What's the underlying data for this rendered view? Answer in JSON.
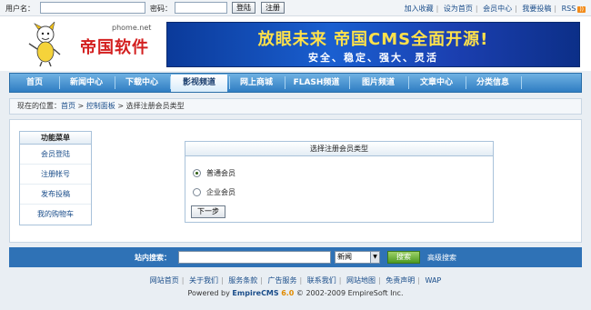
{
  "topbar": {
    "username_label": "用户名：",
    "password_label": "密码：",
    "login_button": "登陆",
    "register_button": "注册",
    "links": [
      "加入收藏",
      "设为首页",
      "会员中心",
      "我要投稿",
      "RSS"
    ]
  },
  "header": {
    "logo_site": "phome.net",
    "logo_text": "帝国软件",
    "banner_line1": "放眼未来 帝国CMS全面开源!",
    "banner_line2": "安全、稳定、强大、灵活"
  },
  "nav": {
    "items": [
      "首页",
      "新闻中心",
      "下载中心",
      "影视频道",
      "网上商城",
      "FLASH频道",
      "图片频道",
      "文章中心",
      "分类信息"
    ],
    "active_index": 3
  },
  "breadcrumb": {
    "prefix": "现在的位置：",
    "home": "首页",
    "sep1": " > ",
    "panel": "控制面板",
    "sep2": " > ",
    "current": "选择注册会员类型"
  },
  "menu": {
    "title": "功能菜单",
    "items": [
      "会员登陆",
      "注册帐号",
      "发布投稿",
      "我的购物车"
    ]
  },
  "panel": {
    "title": "选择注册会员类型",
    "options": [
      "普通会员",
      "企业会员"
    ],
    "selected_index": 0,
    "next_button": "下一步"
  },
  "search": {
    "label": "站内搜索：",
    "input_value": "",
    "select_value": "新闻",
    "go_button": "搜索",
    "advanced": "高级搜索"
  },
  "footer": {
    "links": [
      "网站首页",
      "关于我们",
      "服务条款",
      "广告服务",
      "联系我们",
      "网站地图",
      "免责声明",
      "WAP"
    ],
    "powered_prefix": "Powered by ",
    "brand": "EmpireCMS",
    "version": "6.0",
    "copyright": "© 2002-2009 EmpireSoft Inc."
  }
}
